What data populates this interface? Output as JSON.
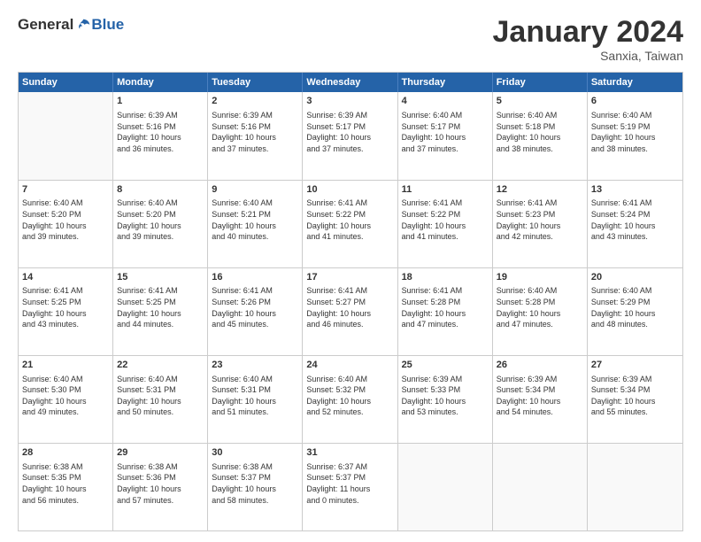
{
  "logo": {
    "general": "General",
    "blue": "Blue"
  },
  "title": "January 2024",
  "location": "Sanxia, Taiwan",
  "header_days": [
    "Sunday",
    "Monday",
    "Tuesday",
    "Wednesday",
    "Thursday",
    "Friday",
    "Saturday"
  ],
  "weeks": [
    [
      {
        "day": "",
        "info": ""
      },
      {
        "day": "1",
        "info": "Sunrise: 6:39 AM\nSunset: 5:16 PM\nDaylight: 10 hours\nand 36 minutes."
      },
      {
        "day": "2",
        "info": "Sunrise: 6:39 AM\nSunset: 5:16 PM\nDaylight: 10 hours\nand 37 minutes."
      },
      {
        "day": "3",
        "info": "Sunrise: 6:39 AM\nSunset: 5:17 PM\nDaylight: 10 hours\nand 37 minutes."
      },
      {
        "day": "4",
        "info": "Sunrise: 6:40 AM\nSunset: 5:17 PM\nDaylight: 10 hours\nand 37 minutes."
      },
      {
        "day": "5",
        "info": "Sunrise: 6:40 AM\nSunset: 5:18 PM\nDaylight: 10 hours\nand 38 minutes."
      },
      {
        "day": "6",
        "info": "Sunrise: 6:40 AM\nSunset: 5:19 PM\nDaylight: 10 hours\nand 38 minutes."
      }
    ],
    [
      {
        "day": "7",
        "info": "Sunrise: 6:40 AM\nSunset: 5:20 PM\nDaylight: 10 hours\nand 39 minutes."
      },
      {
        "day": "8",
        "info": "Sunrise: 6:40 AM\nSunset: 5:20 PM\nDaylight: 10 hours\nand 39 minutes."
      },
      {
        "day": "9",
        "info": "Sunrise: 6:40 AM\nSunset: 5:21 PM\nDaylight: 10 hours\nand 40 minutes."
      },
      {
        "day": "10",
        "info": "Sunrise: 6:41 AM\nSunset: 5:22 PM\nDaylight: 10 hours\nand 41 minutes."
      },
      {
        "day": "11",
        "info": "Sunrise: 6:41 AM\nSunset: 5:22 PM\nDaylight: 10 hours\nand 41 minutes."
      },
      {
        "day": "12",
        "info": "Sunrise: 6:41 AM\nSunset: 5:23 PM\nDaylight: 10 hours\nand 42 minutes."
      },
      {
        "day": "13",
        "info": "Sunrise: 6:41 AM\nSunset: 5:24 PM\nDaylight: 10 hours\nand 43 minutes."
      }
    ],
    [
      {
        "day": "14",
        "info": "Sunrise: 6:41 AM\nSunset: 5:25 PM\nDaylight: 10 hours\nand 43 minutes."
      },
      {
        "day": "15",
        "info": "Sunrise: 6:41 AM\nSunset: 5:25 PM\nDaylight: 10 hours\nand 44 minutes."
      },
      {
        "day": "16",
        "info": "Sunrise: 6:41 AM\nSunset: 5:26 PM\nDaylight: 10 hours\nand 45 minutes."
      },
      {
        "day": "17",
        "info": "Sunrise: 6:41 AM\nSunset: 5:27 PM\nDaylight: 10 hours\nand 46 minutes."
      },
      {
        "day": "18",
        "info": "Sunrise: 6:41 AM\nSunset: 5:28 PM\nDaylight: 10 hours\nand 47 minutes."
      },
      {
        "day": "19",
        "info": "Sunrise: 6:40 AM\nSunset: 5:28 PM\nDaylight: 10 hours\nand 47 minutes."
      },
      {
        "day": "20",
        "info": "Sunrise: 6:40 AM\nSunset: 5:29 PM\nDaylight: 10 hours\nand 48 minutes."
      }
    ],
    [
      {
        "day": "21",
        "info": "Sunrise: 6:40 AM\nSunset: 5:30 PM\nDaylight: 10 hours\nand 49 minutes."
      },
      {
        "day": "22",
        "info": "Sunrise: 6:40 AM\nSunset: 5:31 PM\nDaylight: 10 hours\nand 50 minutes."
      },
      {
        "day": "23",
        "info": "Sunrise: 6:40 AM\nSunset: 5:31 PM\nDaylight: 10 hours\nand 51 minutes."
      },
      {
        "day": "24",
        "info": "Sunrise: 6:40 AM\nSunset: 5:32 PM\nDaylight: 10 hours\nand 52 minutes."
      },
      {
        "day": "25",
        "info": "Sunrise: 6:39 AM\nSunset: 5:33 PM\nDaylight: 10 hours\nand 53 minutes."
      },
      {
        "day": "26",
        "info": "Sunrise: 6:39 AM\nSunset: 5:34 PM\nDaylight: 10 hours\nand 54 minutes."
      },
      {
        "day": "27",
        "info": "Sunrise: 6:39 AM\nSunset: 5:34 PM\nDaylight: 10 hours\nand 55 minutes."
      }
    ],
    [
      {
        "day": "28",
        "info": "Sunrise: 6:38 AM\nSunset: 5:35 PM\nDaylight: 10 hours\nand 56 minutes."
      },
      {
        "day": "29",
        "info": "Sunrise: 6:38 AM\nSunset: 5:36 PM\nDaylight: 10 hours\nand 57 minutes."
      },
      {
        "day": "30",
        "info": "Sunrise: 6:38 AM\nSunset: 5:37 PM\nDaylight: 10 hours\nand 58 minutes."
      },
      {
        "day": "31",
        "info": "Sunrise: 6:37 AM\nSunset: 5:37 PM\nDaylight: 11 hours\nand 0 minutes."
      },
      {
        "day": "",
        "info": ""
      },
      {
        "day": "",
        "info": ""
      },
      {
        "day": "",
        "info": ""
      }
    ]
  ]
}
